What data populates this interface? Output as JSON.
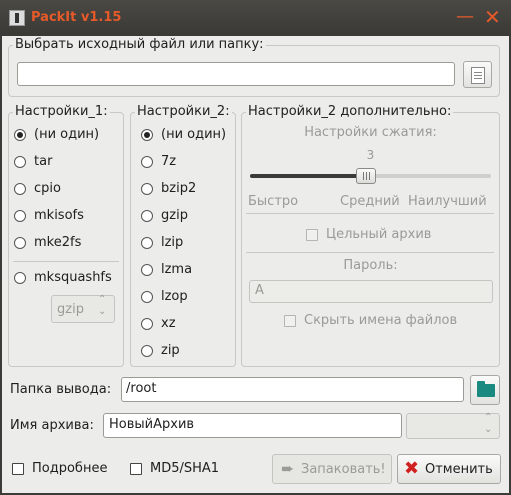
{
  "window": {
    "title": "PackIt v1.15"
  },
  "source": {
    "label": "Выбрать исходный файл или папку:",
    "value": ""
  },
  "settings1": {
    "title": "Настройки_1:",
    "options": [
      "(ни один)",
      "tar",
      "cpio",
      "mkisofs",
      "mke2fs",
      "mksquashfs"
    ],
    "selected": "(ни один)",
    "compressor": "gzip"
  },
  "settings2": {
    "title": "Настройки_2:",
    "options": [
      "(ни один)",
      "7z",
      "bzip2",
      "gzip",
      "lzip",
      "lzma",
      "lzop",
      "xz",
      "zip"
    ],
    "selected": "(ни один)"
  },
  "advanced": {
    "title": "Настройки_2 дополнительно:",
    "compression_label": "Настройки сжатия:",
    "compression_value": "3",
    "compression_level": 3,
    "compression_max": 9,
    "marks": [
      "Быстро",
      "Средний",
      "Наилучший"
    ],
    "solid_label": "Цельный архив",
    "password_label": "Пароль:",
    "password_value": "A",
    "hide_names_label": "Скрыть имена файлов"
  },
  "output": {
    "label": "Папка вывода:",
    "value": "/root"
  },
  "archive": {
    "label": "Имя архива:",
    "value": "НовыйАрхив",
    "format": ""
  },
  "footer": {
    "verbose_label": "Подробнее",
    "checksum_label": "MD5/SHA1",
    "pack_label": "Запаковать!",
    "cancel_label": "Отменить"
  },
  "colors": {
    "title_accent": "#e65a2a",
    "folder_icon": "#1a8a80",
    "cancel_icon": "#d02020"
  }
}
